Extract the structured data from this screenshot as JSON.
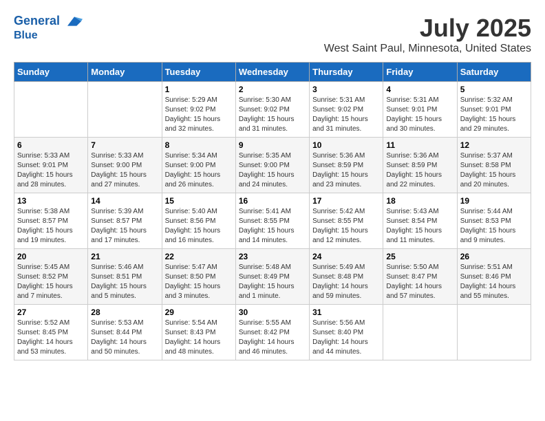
{
  "logo": {
    "line1": "General",
    "line2": "Blue"
  },
  "title": "July 2025",
  "subtitle": "West Saint Paul, Minnesota, United States",
  "weekdays": [
    "Sunday",
    "Monday",
    "Tuesday",
    "Wednesday",
    "Thursday",
    "Friday",
    "Saturday"
  ],
  "weeks": [
    [
      {
        "day": "",
        "info": ""
      },
      {
        "day": "",
        "info": ""
      },
      {
        "day": "1",
        "sunrise": "5:29 AM",
        "sunset": "9:02 PM",
        "daylight": "15 hours and 32 minutes."
      },
      {
        "day": "2",
        "sunrise": "5:30 AM",
        "sunset": "9:02 PM",
        "daylight": "15 hours and 31 minutes."
      },
      {
        "day": "3",
        "sunrise": "5:31 AM",
        "sunset": "9:02 PM",
        "daylight": "15 hours and 31 minutes."
      },
      {
        "day": "4",
        "sunrise": "5:31 AM",
        "sunset": "9:01 PM",
        "daylight": "15 hours and 30 minutes."
      },
      {
        "day": "5",
        "sunrise": "5:32 AM",
        "sunset": "9:01 PM",
        "daylight": "15 hours and 29 minutes."
      }
    ],
    [
      {
        "day": "6",
        "sunrise": "5:33 AM",
        "sunset": "9:01 PM",
        "daylight": "15 hours and 28 minutes."
      },
      {
        "day": "7",
        "sunrise": "5:33 AM",
        "sunset": "9:00 PM",
        "daylight": "15 hours and 27 minutes."
      },
      {
        "day": "8",
        "sunrise": "5:34 AM",
        "sunset": "9:00 PM",
        "daylight": "15 hours and 26 minutes."
      },
      {
        "day": "9",
        "sunrise": "5:35 AM",
        "sunset": "9:00 PM",
        "daylight": "15 hours and 24 minutes."
      },
      {
        "day": "10",
        "sunrise": "5:36 AM",
        "sunset": "8:59 PM",
        "daylight": "15 hours and 23 minutes."
      },
      {
        "day": "11",
        "sunrise": "5:36 AM",
        "sunset": "8:59 PM",
        "daylight": "15 hours and 22 minutes."
      },
      {
        "day": "12",
        "sunrise": "5:37 AM",
        "sunset": "8:58 PM",
        "daylight": "15 hours and 20 minutes."
      }
    ],
    [
      {
        "day": "13",
        "sunrise": "5:38 AM",
        "sunset": "8:57 PM",
        "daylight": "15 hours and 19 minutes."
      },
      {
        "day": "14",
        "sunrise": "5:39 AM",
        "sunset": "8:57 PM",
        "daylight": "15 hours and 17 minutes."
      },
      {
        "day": "15",
        "sunrise": "5:40 AM",
        "sunset": "8:56 PM",
        "daylight": "15 hours and 16 minutes."
      },
      {
        "day": "16",
        "sunrise": "5:41 AM",
        "sunset": "8:55 PM",
        "daylight": "15 hours and 14 minutes."
      },
      {
        "day": "17",
        "sunrise": "5:42 AM",
        "sunset": "8:55 PM",
        "daylight": "15 hours and 12 minutes."
      },
      {
        "day": "18",
        "sunrise": "5:43 AM",
        "sunset": "8:54 PM",
        "daylight": "15 hours and 11 minutes."
      },
      {
        "day": "19",
        "sunrise": "5:44 AM",
        "sunset": "8:53 PM",
        "daylight": "15 hours and 9 minutes."
      }
    ],
    [
      {
        "day": "20",
        "sunrise": "5:45 AM",
        "sunset": "8:52 PM",
        "daylight": "15 hours and 7 minutes."
      },
      {
        "day": "21",
        "sunrise": "5:46 AM",
        "sunset": "8:51 PM",
        "daylight": "15 hours and 5 minutes."
      },
      {
        "day": "22",
        "sunrise": "5:47 AM",
        "sunset": "8:50 PM",
        "daylight": "15 hours and 3 minutes."
      },
      {
        "day": "23",
        "sunrise": "5:48 AM",
        "sunset": "8:49 PM",
        "daylight": "15 hours and 1 minute."
      },
      {
        "day": "24",
        "sunrise": "5:49 AM",
        "sunset": "8:48 PM",
        "daylight": "14 hours and 59 minutes."
      },
      {
        "day": "25",
        "sunrise": "5:50 AM",
        "sunset": "8:47 PM",
        "daylight": "14 hours and 57 minutes."
      },
      {
        "day": "26",
        "sunrise": "5:51 AM",
        "sunset": "8:46 PM",
        "daylight": "14 hours and 55 minutes."
      }
    ],
    [
      {
        "day": "27",
        "sunrise": "5:52 AM",
        "sunset": "8:45 PM",
        "daylight": "14 hours and 53 minutes."
      },
      {
        "day": "28",
        "sunrise": "5:53 AM",
        "sunset": "8:44 PM",
        "daylight": "14 hours and 50 minutes."
      },
      {
        "day": "29",
        "sunrise": "5:54 AM",
        "sunset": "8:43 PM",
        "daylight": "14 hours and 48 minutes."
      },
      {
        "day": "30",
        "sunrise": "5:55 AM",
        "sunset": "8:42 PM",
        "daylight": "14 hours and 46 minutes."
      },
      {
        "day": "31",
        "sunrise": "5:56 AM",
        "sunset": "8:40 PM",
        "daylight": "14 hours and 44 minutes."
      },
      {
        "day": "",
        "info": ""
      },
      {
        "day": "",
        "info": ""
      }
    ]
  ],
  "labels": {
    "sunrise": "Sunrise:",
    "sunset": "Sunset:",
    "daylight": "Daylight:"
  }
}
